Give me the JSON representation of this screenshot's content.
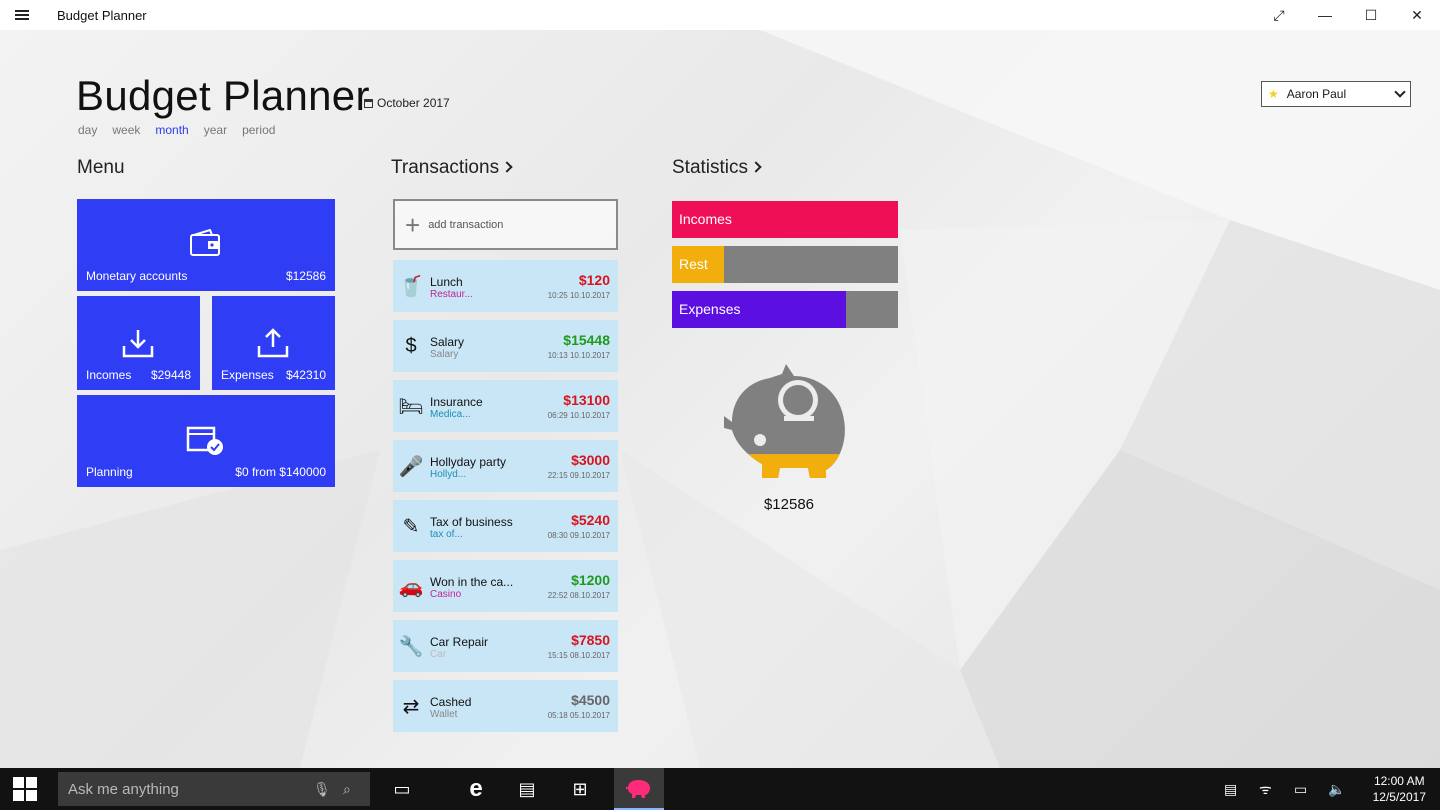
{
  "window": {
    "title": "Budget Planner",
    "controls": {
      "fullscreen": "⤢",
      "minimize": "—",
      "maximize": "☐",
      "close": "✕"
    }
  },
  "header": {
    "title": "Budget Planner",
    "date": "October 2017",
    "periods": [
      "day",
      "week",
      "month",
      "year",
      "period"
    ],
    "active_period": "month",
    "user": "Aaron Paul"
  },
  "sections": {
    "menu": "Menu",
    "transactions": "Transactions",
    "statistics": "Statistics"
  },
  "menu_tiles": {
    "monetary": {
      "label": "Monetary accounts",
      "value": "$12586",
      "icon": "wallet-icon"
    },
    "incomes": {
      "label": "Incomes",
      "value": "$29448",
      "icon": "download-icon"
    },
    "expenses": {
      "label": "Expenses",
      "value": "$42310",
      "icon": "upload-icon"
    },
    "planning": {
      "label": "Planning",
      "value": "$0 from $140000",
      "icon": "planning-icon"
    }
  },
  "add_transaction": "add transaction",
  "transactions": [
    {
      "name": "Lunch",
      "category": "Restaur...",
      "amount": "$120",
      "time": "10:25 10.10.2017",
      "icon": "drink-icon",
      "glyph": "🥤",
      "cat_color": "#c0249a",
      "amt_color": "#d8141e"
    },
    {
      "name": "Salary",
      "category": "Salary",
      "amount": "$15448",
      "time": "10:13 10.10.2017",
      "icon": "dollar-icon",
      "glyph": "$",
      "cat_color": "#888888",
      "amt_color": "#1e9a1e"
    },
    {
      "name": "Insurance",
      "category": "Medica...",
      "amount": "$13100",
      "time": "06:29 10.10.2017",
      "icon": "hospital-bed-icon",
      "glyph": "🛏",
      "cat_color": "#1c8fb6",
      "amt_color": "#d8141e"
    },
    {
      "name": "Hollyday party",
      "category": "Hollyd...",
      "amount": "$3000",
      "time": "22:15 09.10.2017",
      "icon": "maracas-icon",
      "glyph": "🎤",
      "cat_color": "#1c8fb6",
      "amt_color": "#d8141e"
    },
    {
      "name": "Tax of business",
      "category": "tax of...",
      "amount": "$5240",
      "time": "08:30 09.10.2017",
      "icon": "pencil-icon",
      "glyph": "✎",
      "cat_color": "#1c8fb6",
      "amt_color": "#d8141e"
    },
    {
      "name": "Won in the ca...",
      "category": "Casino",
      "amount": "$1200",
      "time": "22:52 08.10.2017",
      "icon": "car-icon",
      "glyph": "🚗",
      "cat_color": "#c0249a",
      "amt_color": "#1e9a1e"
    },
    {
      "name": "Car Repair",
      "category": "Car",
      "amount": "$7850",
      "time": "15:15 08.10.2017",
      "icon": "car-repair-icon",
      "glyph": "🔧",
      "cat_color": "#bbbbbb",
      "amt_color": "#d8141e"
    },
    {
      "name": "Cashed",
      "category": "Wallet",
      "amount": "$4500",
      "time": "05:18 05.10.2017",
      "icon": "exchange-icon",
      "glyph": "⇄",
      "cat_color": "#888888",
      "amt_color": "#666666"
    }
  ],
  "statistics": {
    "bars": [
      {
        "label": "Incomes",
        "fraction": 1.0,
        "color": "#ef0f57"
      },
      {
        "label": "Rest",
        "fraction": 0.23,
        "color": "#f1ae0c"
      },
      {
        "label": "Expenses",
        "fraction": 0.77,
        "color": "#5b0fe0"
      }
    ],
    "piggy_value": "$12586",
    "piggy_fill_fraction": 0.23
  },
  "taskbar": {
    "search_placeholder": "Ask me anything",
    "time": "12:00 AM",
    "date": "12/5/2017"
  },
  "colors": {
    "tile_blue": "#2f3df5",
    "tx_bg": "#c9e6f6",
    "piggy_gray": "#808080",
    "piggy_gold": "#f1ae0c"
  }
}
